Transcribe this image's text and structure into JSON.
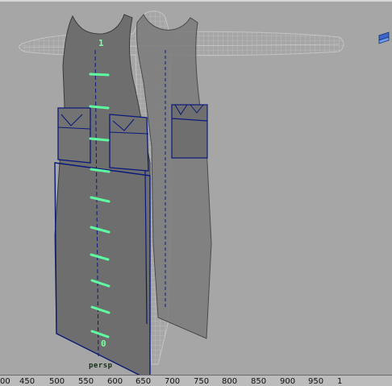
{
  "viewport": {
    "camera_label": "persp",
    "curve_label_top": "1",
    "curve_label_bottom": "0"
  },
  "timeline": {
    "ticks": [
      "00",
      "450",
      "500",
      "550",
      "600",
      "650",
      "700",
      "750",
      "800",
      "850",
      "900",
      "950",
      "1"
    ]
  },
  "colors": {
    "viewport_bg": "#a6a6a6",
    "cloth_fill": "#6e6e6e",
    "panel_outline": "#0a1a7a",
    "wireframe": "#c8c8c8",
    "curve_cv": "#5dffa0"
  }
}
